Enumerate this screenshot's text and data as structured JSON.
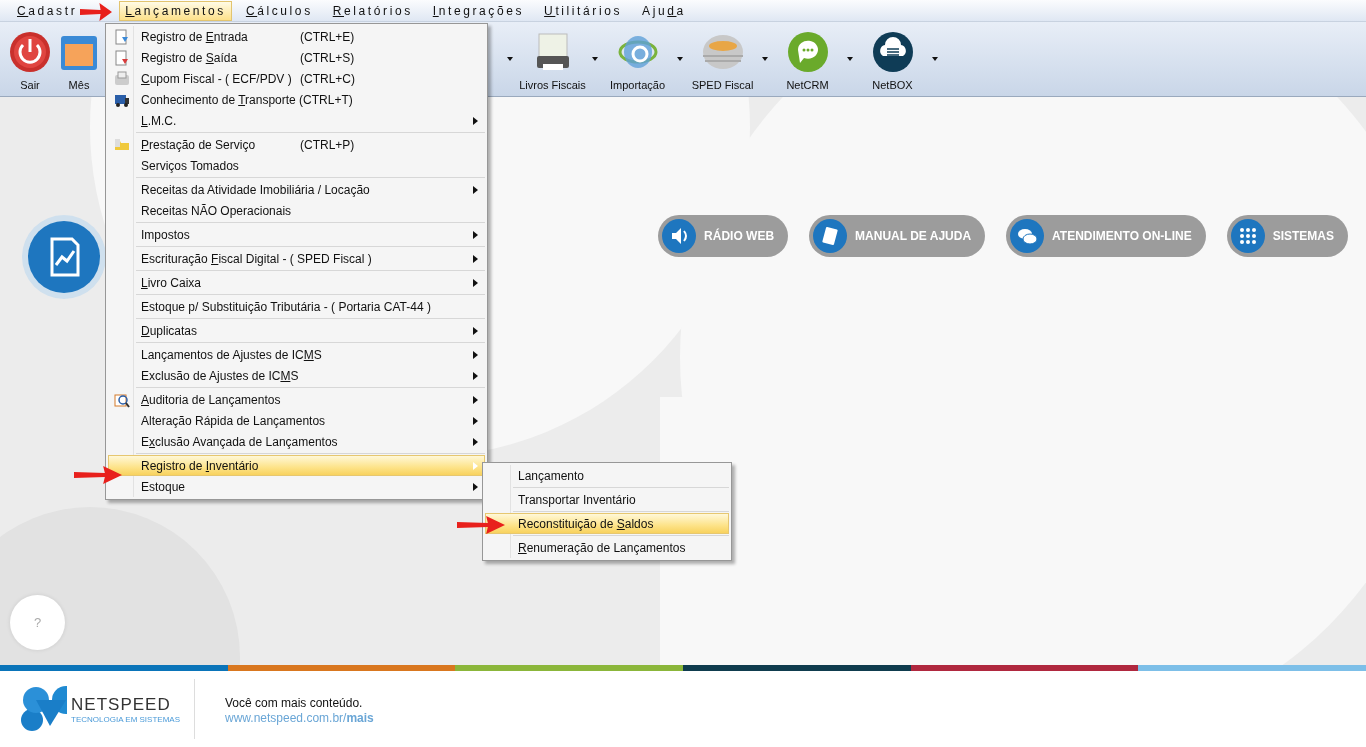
{
  "menubar": [
    {
      "key": "C",
      "after": "adastr",
      "selected": false
    },
    {
      "key": "L",
      "after": "ançamentos",
      "selected": true
    },
    {
      "key": "C",
      "after": "álculos",
      "selected": false
    },
    {
      "key": "R",
      "after": "elatórios",
      "selected": false
    },
    {
      "key": "I",
      "after": "ntegrações",
      "selected": false
    },
    {
      "key": "U",
      "after": "tilitários",
      "selected": false
    },
    {
      "before": "Aju",
      "key": "d",
      "after": "a",
      "selected": false
    }
  ],
  "toolbar": [
    {
      "label": "Sair",
      "dropdown": false
    },
    {
      "label": "Mês",
      "dropdown": false
    },
    {
      "label": "Livros Fiscais",
      "dropdown": true
    },
    {
      "label": "Importação",
      "dropdown": true
    },
    {
      "label": "SPED Fiscal",
      "dropdown": true
    },
    {
      "label": "NetCRM",
      "dropdown": true
    },
    {
      "label": "NetBOX",
      "dropdown": true
    }
  ],
  "menu": {
    "groups": [
      [
        {
          "before": "Registro de ",
          "key": "E",
          "after": "ntrada",
          "shortcut": "(CTRL+E)",
          "submenu": false,
          "selected": false
        },
        {
          "before": "Registro de ",
          "key": "S",
          "after": "aída",
          "shortcut": "(CTRL+S)",
          "submenu": false,
          "selected": false
        },
        {
          "key": "C",
          "after": "upom Fiscal - ( ECF/PDV )",
          "shortcut": "(CTRL+C)",
          "submenu": false,
          "selected": false
        },
        {
          "before": "Conhecimento de ",
          "key": "T",
          "after": "ransporte (CTRL+T)",
          "submenu": false,
          "selected": false
        },
        {
          "key": "L",
          "after": ".M.C.",
          "submenu": true,
          "selected": false
        }
      ],
      [
        {
          "key": "P",
          "after": "restação de Serviço",
          "shortcut": "(CTRL+P)",
          "submenu": false,
          "selected": false
        },
        {
          "before": "Serviços Tomados",
          "submenu": false,
          "selected": false
        }
      ],
      [
        {
          "before": "Receitas da Atividade Imobiliária / Locação",
          "submenu": true,
          "selected": false
        },
        {
          "before": "Receitas NÃO Operacionais",
          "submenu": false,
          "selected": false
        }
      ],
      [
        {
          "before": "Impostos",
          "submenu": true,
          "selected": false
        }
      ],
      [
        {
          "before": "Escrituração ",
          "key": "F",
          "after": "iscal Digital - ( SPED Fiscal )",
          "submenu": true,
          "selected": false
        }
      ],
      [
        {
          "key": "L",
          "after": "ivro Caixa",
          "submenu": true,
          "selected": false
        }
      ],
      [
        {
          "before": "Estoque p/ Substituição Tributária - ( Portaria CAT-44 )",
          "submenu": false,
          "selected": false
        }
      ],
      [
        {
          "key": "D",
          "after": "uplicatas",
          "submenu": true,
          "selected": false
        }
      ],
      [
        {
          "before": "Lançamentos de Ajustes de IC",
          "key": "M",
          "after": "S",
          "submenu": true,
          "selected": false
        },
        {
          "before": "Exclusão de Ajustes de IC",
          "key": "M",
          "after": "S",
          "submenu": true,
          "selected": false
        }
      ],
      [
        {
          "key": "A",
          "after": "uditoria de Lançamentos",
          "submenu": true,
          "selected": false
        },
        {
          "before": "Alteração Rápida de Lançamentos",
          "submenu": true,
          "selected": false
        },
        {
          "before": "E",
          "key": "x",
          "after": "clusão Avançada de Lançamentos",
          "submenu": true,
          "selected": false
        }
      ],
      [
        {
          "before": "Registro de ",
          "key": "I",
          "after": "nventário",
          "submenu": true,
          "selected": true
        },
        {
          "before": "Estoque",
          "submenu": true,
          "selected": false
        }
      ]
    ]
  },
  "submenu": [
    {
      "before": "Lançamento",
      "selected": false
    },
    {
      "before": "Transportar Inventário",
      "selected": false
    },
    {
      "before": "Reconstituição de ",
      "key": "S",
      "after": "aldos",
      "selected": true
    },
    {
      "key": "R",
      "after": "enumeração de Lançamentos",
      "selected": false
    }
  ],
  "quick_links": [
    "RÁDIO WEB",
    "MANUAL DE AJUDA",
    "ATENDIMENTO ON-LINE",
    "SISTEMAS"
  ],
  "help_button": "?",
  "footer": {
    "brand": "NETSPEED",
    "tagline": "TECNOLOGIA EM SISTEMAS",
    "message": "Você com mais conteúdo.",
    "link_before": "www.netspeed.com.br/",
    "link_bold": "mais",
    "stripe": [
      {
        "color": "#0a74b9"
      },
      {
        "color": "#d9771f"
      },
      {
        "color": "#8bb63a"
      },
      {
        "color": "#0f3c4e"
      },
      {
        "color": "#b0283f"
      },
      {
        "color": "#7dbfe8"
      }
    ]
  }
}
